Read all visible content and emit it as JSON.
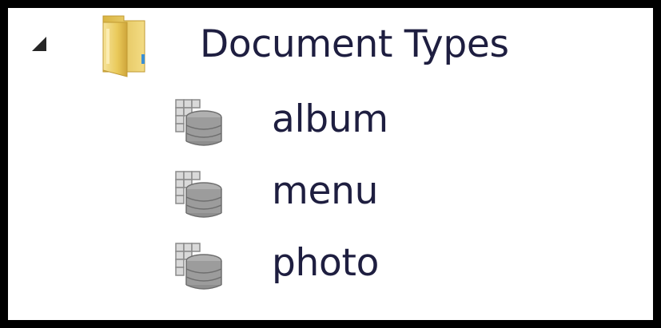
{
  "tree": {
    "root": {
      "label": "Document Types",
      "icon": "folder-icon",
      "expanded": true,
      "expander_icon": "expanded-triangle-icon"
    },
    "children": [
      {
        "label": "album",
        "icon": "document-type-icon"
      },
      {
        "label": "menu",
        "icon": "document-type-icon"
      },
      {
        "label": "photo",
        "icon": "document-type-icon"
      }
    ]
  },
  "colors": {
    "frame": "#000000",
    "background": "#ffffff",
    "text": "#1e1e40",
    "folder": "#e9c95a",
    "icon_grid": "#9a9a9a"
  }
}
